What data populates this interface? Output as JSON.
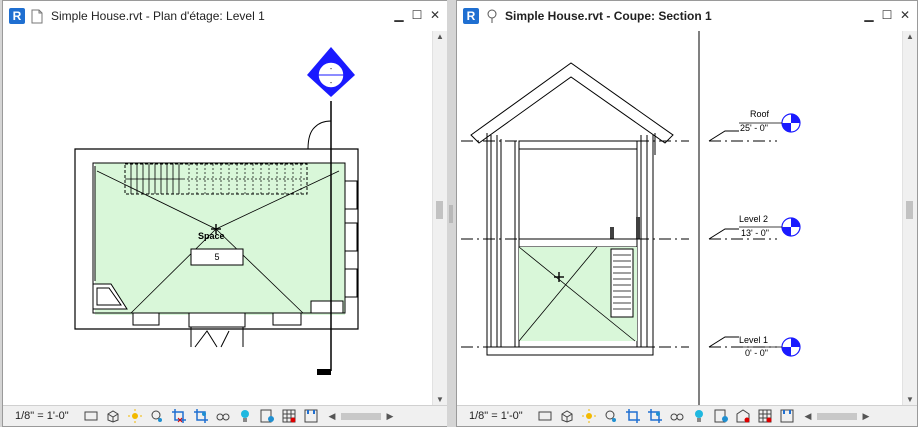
{
  "left_view": {
    "app_badge": "R",
    "doc_icon": "document-icon",
    "title": "Simple House.rvt - Plan d'étage: Level 1",
    "space_label": "Space",
    "space_number": "5",
    "scale": "1/8\" = 1'-0\""
  },
  "right_view": {
    "app_badge": "R",
    "doc_icon": "section-view-icon",
    "title": "Simple House.rvt - Coupe: Section 1",
    "levels": [
      {
        "name": "Roof",
        "elevation": "25' - 0\""
      },
      {
        "name": "Level 2",
        "elevation": "13' - 0\""
      },
      {
        "name": "Level 1",
        "elevation": "0' - 0\""
      }
    ],
    "scale": "1/8\" = 1'-0\""
  },
  "window_controls": [
    "minimize-icon",
    "maximize-icon",
    "close-icon"
  ],
  "statusbar_icons": [
    "detail-level-icon",
    "visual-style-icon",
    "sun-path-icon",
    "shadows-icon",
    "crop-view-icon",
    "show-crop-icon",
    "temporary-hide-icon",
    "reveal-hidden-icon",
    "temporary-view-properties-icon",
    "worksharing-icon",
    "design-options-icon",
    "analytical-model-icon"
  ],
  "accent_color": "#1f6fd1",
  "space_fill": "#d9f7d9",
  "level_head_color": "#1a1aff"
}
